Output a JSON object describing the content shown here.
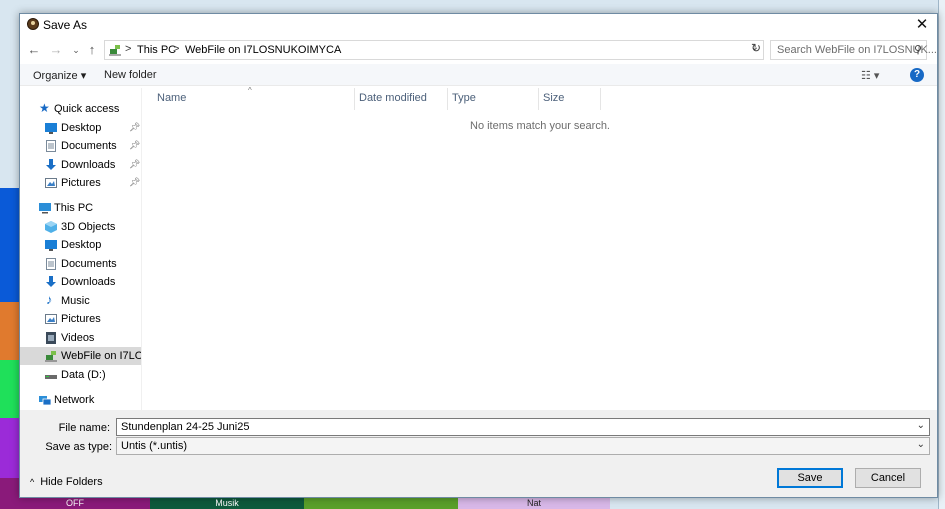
{
  "window": {
    "title": "Save As",
    "close_glyph": "✕"
  },
  "address": {
    "crumbs": [
      "This PC",
      "WebFile on I7LOSNUKOIMYCA"
    ],
    "separator": ">",
    "search_placeholder": "Search WebFile on I7LOSNUK..."
  },
  "toolbar": {
    "organize_label": "Organize ▾",
    "new_folder_label": "New folder",
    "help_glyph": "?"
  },
  "nav": {
    "quick_access": "Quick access",
    "quick_items": [
      "Desktop",
      "Documents",
      "Downloads",
      "Pictures"
    ],
    "this_pc": "This PC",
    "pc_items": [
      "3D Objects",
      "Desktop",
      "Documents",
      "Downloads",
      "Music",
      "Pictures",
      "Videos",
      "WebFile on I7LOSNUKOIMYCA",
      "Data (D:)"
    ],
    "network": "Network"
  },
  "columns": [
    "Name",
    "Date modified",
    "Type",
    "Size"
  ],
  "empty_message": "No items match your search.",
  "form": {
    "file_name_label": "File name:",
    "file_name_value": "Stundenplan 24-25 Juni25",
    "save_type_label": "Save as type:",
    "save_type_value": "Untis (*.untis)"
  },
  "buttons": {
    "hide_folders": "Hide Folders",
    "save": "Save",
    "cancel": "Cancel"
  },
  "background": {
    "bottom_labels": [
      "OFF",
      "Musik",
      "Nat"
    ]
  },
  "colors": {
    "accent": "#0078d7",
    "help": "#1769c5",
    "selection": "#d9d9d9",
    "strip_blue": "#0a5ad8",
    "strip_orange": "#e07a2e",
    "strip_green": "#1fe05a",
    "strip_purple": "#9b2bd8",
    "strip_magenta": "#8a1a7a"
  }
}
